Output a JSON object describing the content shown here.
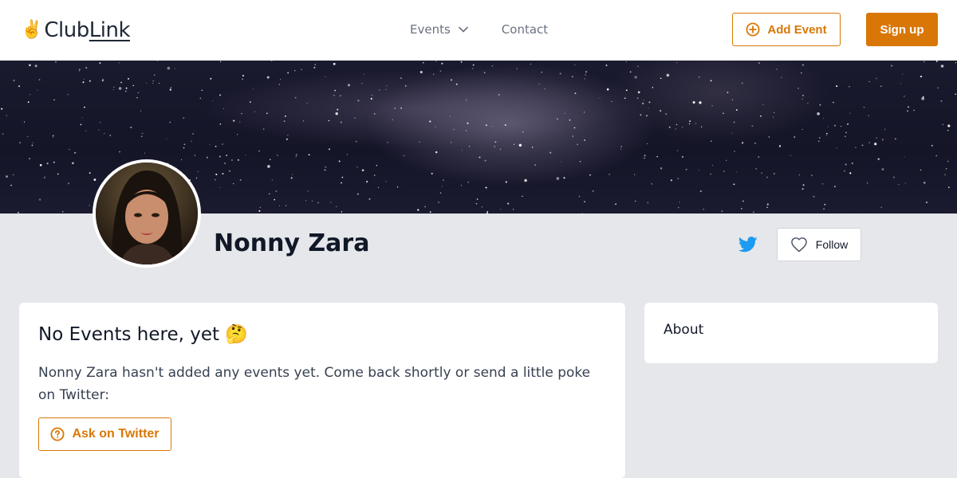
{
  "header": {
    "logo_emoji": "✌️",
    "logo_text_a": "Club",
    "logo_text_b": "Link",
    "nav": {
      "events_label": "Events",
      "contact_label": "Contact"
    },
    "add_event_label": "Add Event",
    "signup_label": "Sign up"
  },
  "profile": {
    "name": "Nonny Zara",
    "follow_label": "Follow",
    "twitter_icon": "twitter-icon"
  },
  "events_card": {
    "title": "No Events here, yet 🤔",
    "body": "Nonny Zara hasn't added any events yet. Come back shortly or send a little poke on Twitter:",
    "ask_label": "Ask on Twitter"
  },
  "about_card": {
    "title": "About"
  },
  "colors": {
    "accent": "#d97706",
    "twitter": "#1d9bf0",
    "page_bg": "#e5e7eb"
  }
}
